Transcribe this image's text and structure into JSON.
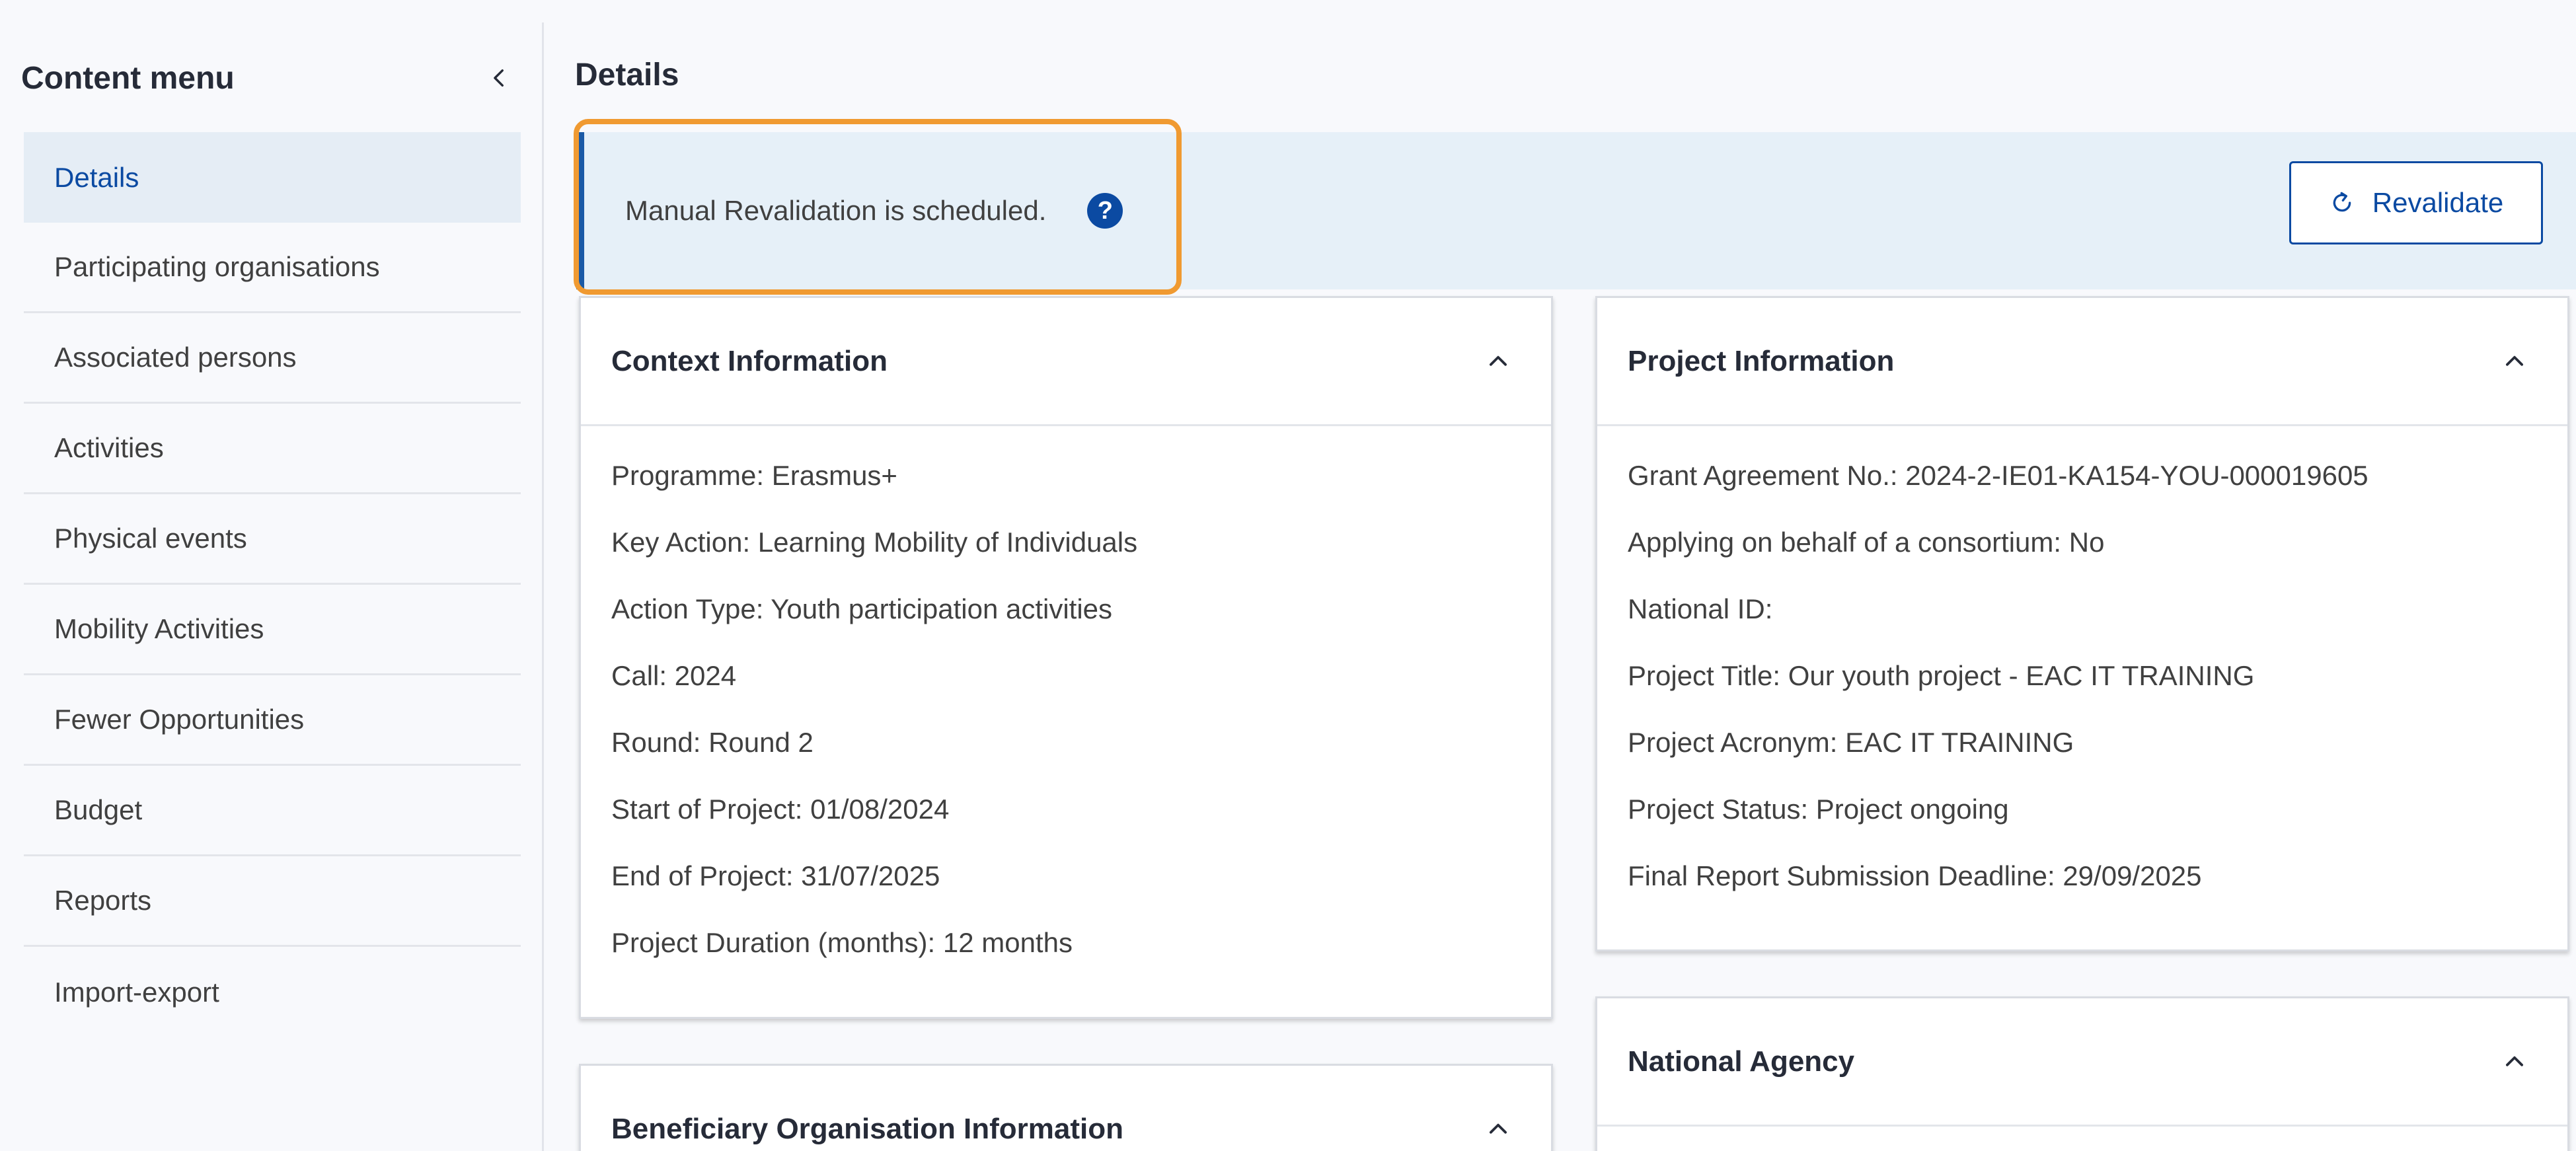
{
  "sidebar": {
    "title": "Content menu",
    "collapse_icon": "chevron-left-icon",
    "items": [
      {
        "label": "Details",
        "active": true
      },
      {
        "label": "Participating organisations"
      },
      {
        "label": "Associated persons"
      },
      {
        "label": "Activities"
      },
      {
        "label": "Physical events"
      },
      {
        "label": "Mobility Activities"
      },
      {
        "label": "Fewer Opportunities"
      },
      {
        "label": "Budget"
      },
      {
        "label": "Reports"
      },
      {
        "label": "Import-export"
      }
    ]
  },
  "main": {
    "title": "Details",
    "notice": {
      "text": "Manual Revalidation is scheduled.",
      "help_icon": "question-circle-icon",
      "highlight_color": "#f09a31"
    },
    "revalidate_button": {
      "label": "Revalidate",
      "icon": "refresh-icon"
    },
    "cards": {
      "context": {
        "title": "Context Information",
        "fields": [
          "Programme: Erasmus+",
          "Key Action: Learning Mobility of Individuals",
          "Action Type: Youth participation activities",
          "Call: 2024",
          "Round: Round 2",
          "Start of Project: 01/08/2024",
          "End of Project: 31/07/2025",
          "Project Duration (months): 12 months"
        ]
      },
      "project": {
        "title": "Project Information",
        "fields": [
          "Grant Agreement No.: 2024-2-IE01-KA154-YOU-000019605",
          "Applying on behalf of a consortium: No",
          "National ID:",
          "Project Title: Our youth project - EAC IT TRAINING",
          "Project Acronym: EAC IT TRAINING",
          "Project Status: Project ongoing",
          "Final Report Submission Deadline: 29/09/2025"
        ]
      },
      "beneficiary": {
        "title": "Beneficiary Organisation Information"
      },
      "agency": {
        "title": "National Agency"
      }
    }
  },
  "colors": {
    "accent": "#0b4aa2",
    "notice_bg": "#e6f0f8",
    "active_item_bg": "#e5edf5"
  }
}
